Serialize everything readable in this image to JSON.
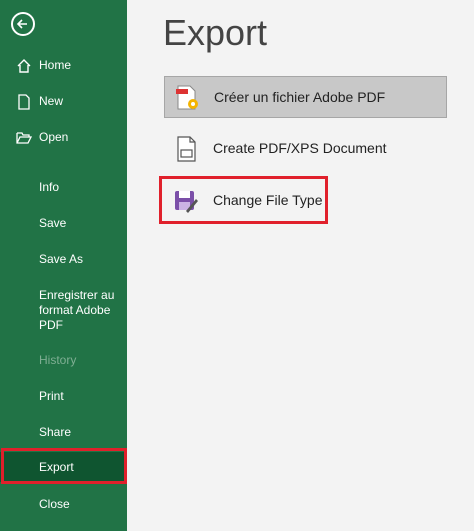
{
  "sidebar": {
    "back_icon": "back-arrow-icon",
    "items": [
      {
        "label": "Home",
        "icon": "home-icon"
      },
      {
        "label": "New",
        "icon": "new-document-icon"
      },
      {
        "label": "Open",
        "icon": "folder-open-icon"
      },
      {
        "label": "Info"
      },
      {
        "label": "Save"
      },
      {
        "label": "Save As"
      },
      {
        "label": "Enregistrer au format Adobe PDF"
      },
      {
        "label": "History"
      },
      {
        "label": "Print"
      },
      {
        "label": "Share"
      },
      {
        "label": "Export"
      },
      {
        "label": "Close"
      }
    ],
    "selected": "Export",
    "colors": {
      "background": "#217346",
      "selected": "#0f5530",
      "highlight": "#e0202b"
    }
  },
  "main": {
    "title": "Export",
    "options": [
      {
        "label": "Créer un fichier Adobe PDF",
        "icon": "adobe-pdf-icon"
      },
      {
        "label": "Create PDF/XPS Document",
        "icon": "pdf-xps-document-icon"
      },
      {
        "label": "Change File Type",
        "icon": "change-file-type-icon"
      }
    ],
    "selected": "Créer un fichier Adobe PDF"
  }
}
